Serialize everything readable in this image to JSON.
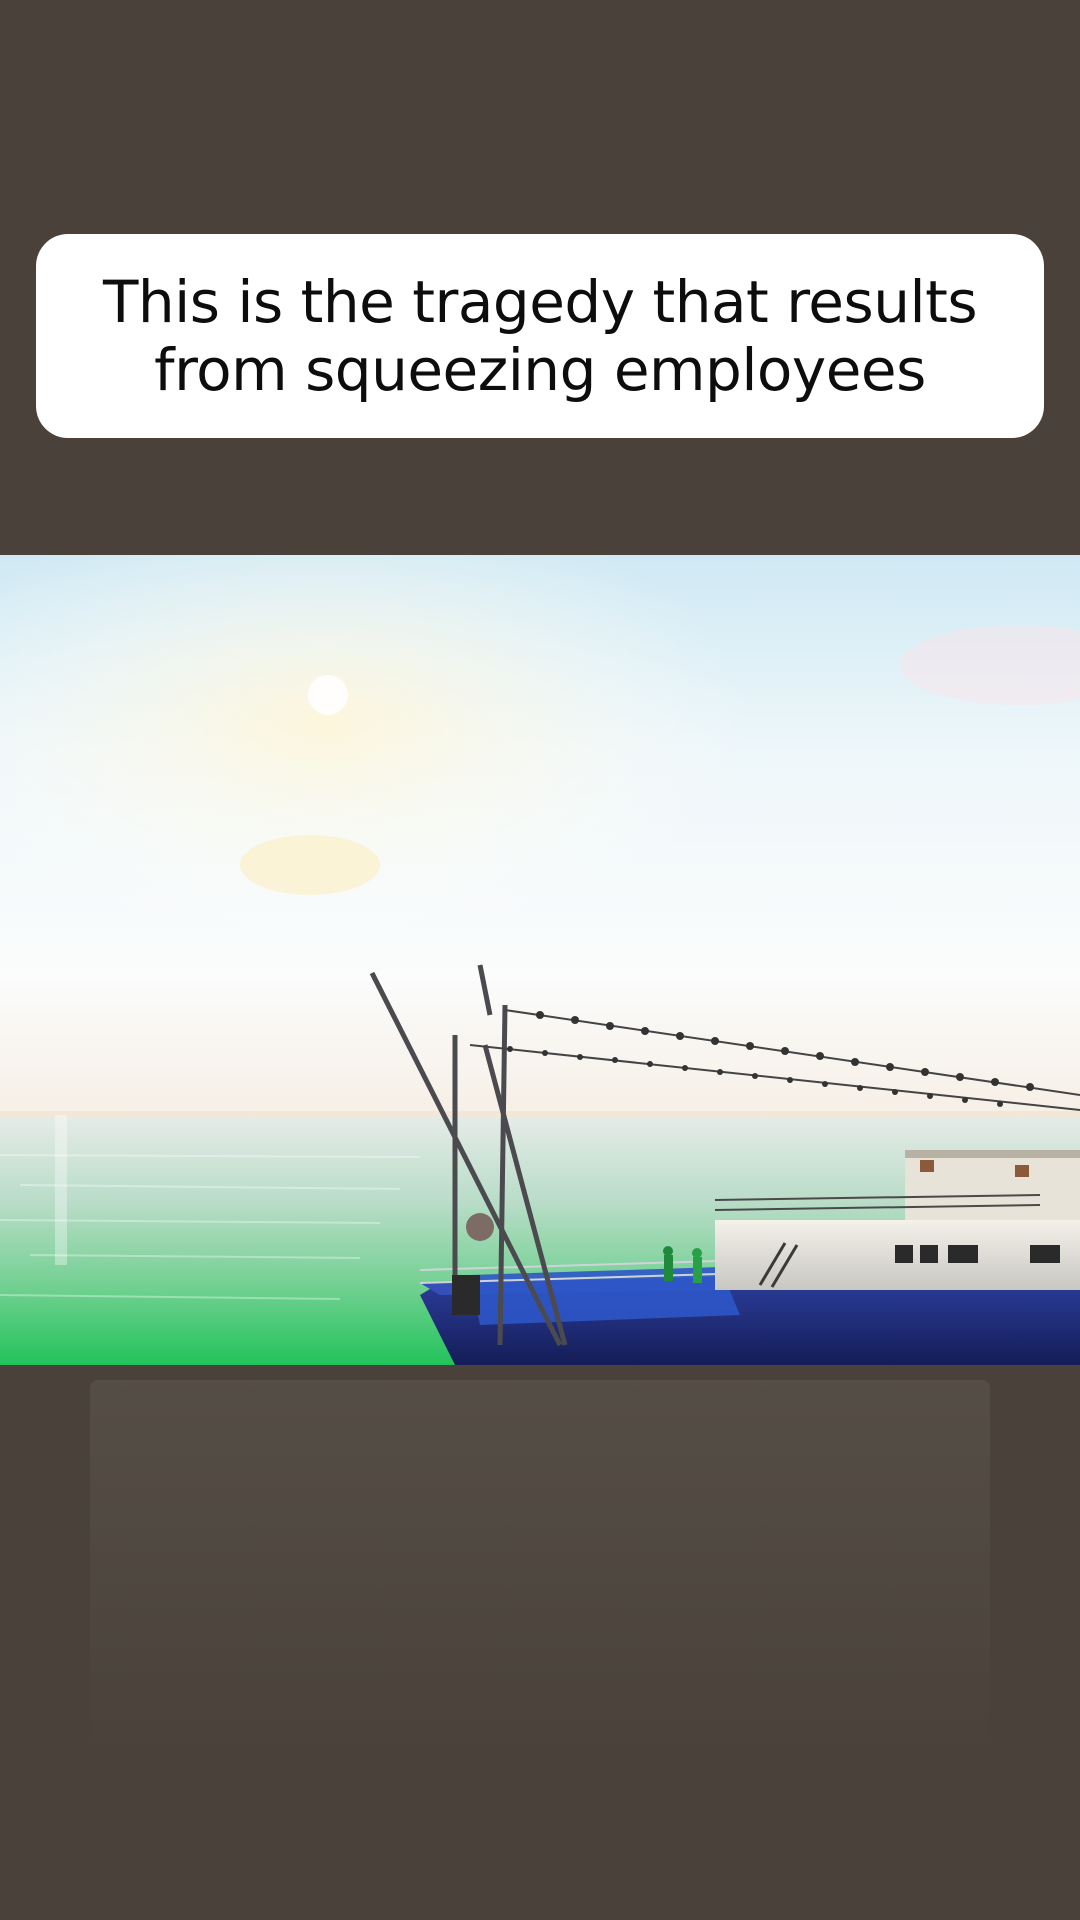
{
  "page": {
    "background_color": "#4a423a"
  },
  "caption": {
    "line1": "This is the tragedy that results",
    "line2": "from squeezing employees",
    "card_color": "#ffffff",
    "text_color": "#0d0d0d"
  },
  "scene": {
    "sky_color": "#dff0f6",
    "sea_color": "#2fc46a",
    "hull_color": "#23307a"
  }
}
